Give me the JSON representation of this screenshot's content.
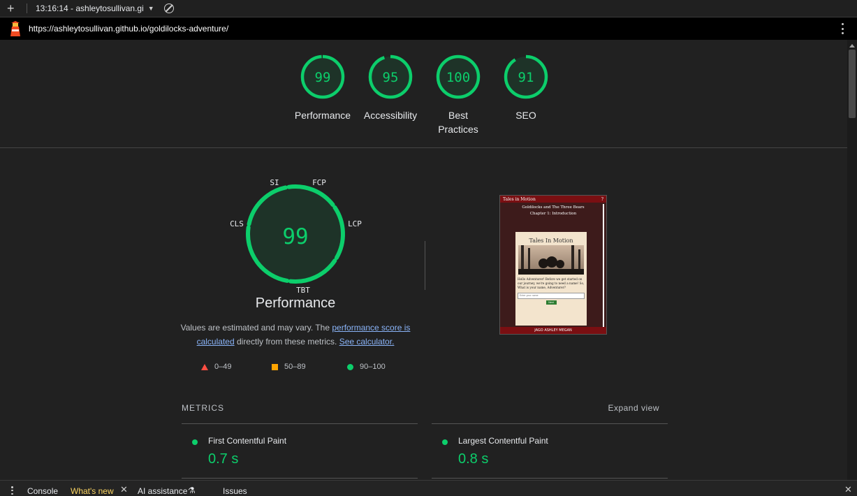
{
  "topbar": {
    "new_label": "+",
    "run_label": "13:16:14 - ashleytosullivan.gi",
    "dropdown_caret": "▼"
  },
  "urlbar": {
    "url": "https://ashleytosullivan.github.io/goldilocks-adventure/"
  },
  "categories": [
    {
      "score": "99",
      "label_line1": "Performance",
      "label_line2": "",
      "fraction": 0.99
    },
    {
      "score": "95",
      "label_line1": "Accessibility",
      "label_line2": "",
      "fraction": 0.95
    },
    {
      "score": "100",
      "label_line1": "Best",
      "label_line2": "Practices",
      "fraction": 1.0
    },
    {
      "score": "91",
      "label_line1": "SEO",
      "label_line2": "",
      "fraction": 0.91
    }
  ],
  "performance": {
    "score": "99",
    "title": "Performance",
    "segment_labels": {
      "si": "SI",
      "fcp": "FCP",
      "lcp": "LCP",
      "tbt": "TBT",
      "cls": "CLS"
    },
    "desc_prefix": "Values are estimated and may vary. The ",
    "desc_link1": "performance score is calculated",
    "desc_middle": " directly from these metrics. ",
    "desc_link2": "See calculator."
  },
  "legend": {
    "fail": "0–49",
    "average": "50–89",
    "pass": "90–100"
  },
  "screenshot": {
    "app_name": "Tales in Motion",
    "help": "?",
    "story_title": "Goldilocks and The Three Bears",
    "chapter": "Chapter 1: Introduction",
    "logo_text": "Tales In Motion",
    "body_text": "Hello Adventurer! Before we get started on our journey, we're going to need a name! So, What is your name, Adventurer?",
    "input_placeholder": "Enter your name",
    "next_button": "Next",
    "footer": "JAGO ASHLEY MEGAN"
  },
  "metrics": {
    "heading": "METRICS",
    "expand": "Expand view",
    "items": [
      {
        "name": "First Contentful Paint",
        "value": "0.7 s"
      },
      {
        "name": "Largest Contentful Paint",
        "value": "0.8 s"
      }
    ]
  },
  "drawer": {
    "tabs": [
      "Console",
      "What's new",
      "AI assistance",
      "Issues"
    ],
    "active_tab": "What's new"
  },
  "colors": {
    "pass": "#0cce6b",
    "average": "#ffa400",
    "fail": "#ff4e42",
    "link": "#8ab4f8"
  }
}
